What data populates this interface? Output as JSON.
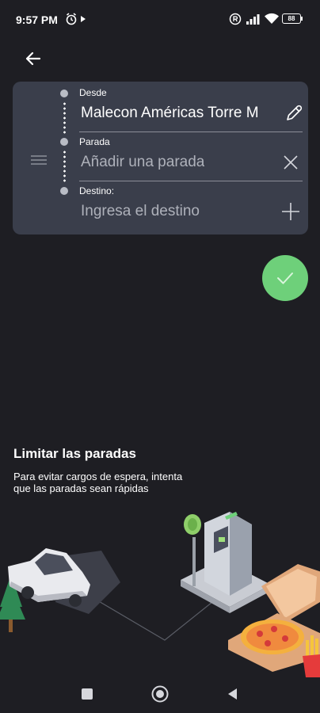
{
  "status_bar": {
    "time": "9:57 PM",
    "left_icons": [
      "alarm-icon",
      "play-icon"
    ],
    "right_icons": [
      "registered-icon",
      "signal-icon",
      "wifi-icon",
      "battery-icon"
    ],
    "battery": "88"
  },
  "header": {
    "back_icon": "arrow-left-icon"
  },
  "route": {
    "origin": {
      "label": "Desde",
      "value": "Malecon Américas Torre M",
      "action_icon": "pencil-icon"
    },
    "stop": {
      "label": "Parada",
      "placeholder": "Añadir una parada",
      "action_icon": "close-icon"
    },
    "destination": {
      "label": "Destino:",
      "placeholder": "Ingresa el destino",
      "action_icon": "plus-icon"
    }
  },
  "confirm": {
    "icon": "checkmark-icon",
    "color": "#6ed07a"
  },
  "tip": {
    "title": "Limitar las paradas",
    "body": "Para evitar cargos de espera, intenta que las paradas sean rápidas"
  },
  "nav_bar": {
    "icons": [
      "recents-square-icon",
      "home-circle-icon",
      "back-triangle-icon"
    ]
  },
  "colors": {
    "background": "#1e1e23",
    "card": "#3a3e4b",
    "accent": "#6ed07a"
  }
}
